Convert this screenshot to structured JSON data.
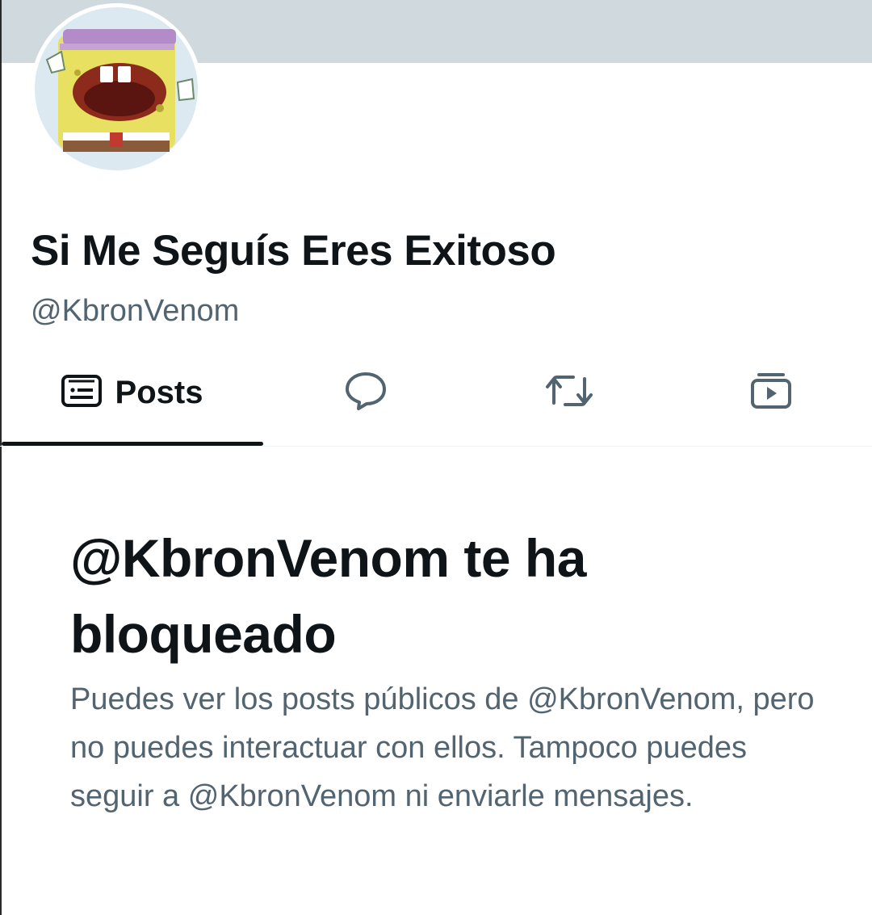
{
  "profile": {
    "display_name": "Si Me Seguís Eres Exitoso",
    "handle": "@KbronVenom",
    "avatar_icon": "profile-avatar",
    "banner_color": "#cfd9de"
  },
  "tabs": [
    {
      "label": "Posts",
      "icon": "posts-icon",
      "selected": true
    },
    {
      "label": "",
      "icon": "replies-icon",
      "selected": false
    },
    {
      "label": "",
      "icon": "repost-icon",
      "selected": false
    },
    {
      "label": "",
      "icon": "media-icon",
      "selected": false
    }
  ],
  "blocked_notice": {
    "title": "@KbronVenom te ha bloqueado",
    "description": "Puedes ver los posts públicos de @KbronVenom, pero no puedes interactuar con ellos. Tampoco puedes seguir a @KbronVenom ni enviarle mensajes."
  },
  "colors": {
    "text_primary": "#0f1419",
    "text_secondary": "#536471",
    "divider": "#eff3f4"
  }
}
